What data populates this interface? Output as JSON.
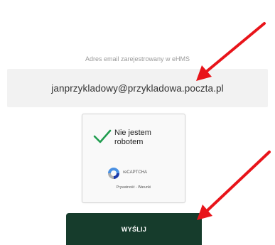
{
  "form": {
    "email_label": "Adres email zarejestrowany w eHMS",
    "email_value": "janprzykladowy@przykladowa.poczta.pl",
    "submit_label": "WYŚLIJ"
  },
  "captcha": {
    "checkbox_text": "Nie jestem robotem",
    "brand": "reCAPTCHA",
    "links": "Prywatność - Warunki",
    "check_color": "#1f9c4e"
  },
  "annotations": {
    "arrow_color": "#e8141a"
  },
  "colors": {
    "button_bg": "#163c2c",
    "field_bg": "#f2f2f2"
  }
}
